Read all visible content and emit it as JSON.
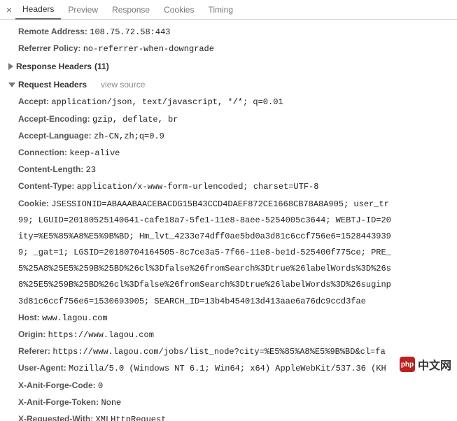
{
  "tabs": {
    "headers": "Headers",
    "preview": "Preview",
    "response": "Response",
    "cookies": "Cookies",
    "timing": "Timing"
  },
  "general": {
    "remote_address_label": "Remote Address:",
    "remote_address_value": "108.75.72.58:443",
    "referrer_policy_label": "Referrer Policy:",
    "referrer_policy_value": "no-referrer-when-downgrade"
  },
  "response_section": {
    "title": "Response Headers",
    "count": "(11)"
  },
  "request_section": {
    "title": "Request Headers",
    "view_source": "view source"
  },
  "request_headers": {
    "accept_label": "Accept:",
    "accept_value": "application/json, text/javascript, */*; q=0.01",
    "accept_encoding_label": "Accept-Encoding:",
    "accept_encoding_value": "gzip, deflate, br",
    "accept_language_label": "Accept-Language:",
    "accept_language_value": "zh-CN,zh;q=0.9",
    "connection_label": "Connection:",
    "connection_value": "keep-alive",
    "content_length_label": "Content-Length:",
    "content_length_value": "23",
    "content_type_label": "Content-Type:",
    "content_type_value": "application/x-www-form-urlencoded; charset=UTF-8",
    "cookie_label": "Cookie:",
    "cookie_line1": "JSESSIONID=ABAAABAACEBACDG15B43CCD4DAEF872CE1668CB78A8A905; user_tr",
    "cookie_line2": "99; LGUID=20180525140641-cafe18a7-5fe1-11e8-8aee-5254005c3644; WEBTJ-ID=20",
    "cookie_line3": "ity=%E5%85%A8%E5%9B%BD; Hm_lvt_4233e74dff0ae5bd0a3d81c6ccf756e6=1528443939",
    "cookie_line4": "9; _gat=1; LGSID=20180704164505-8c7ce3a5-7f66-11e8-be1d-525400f775ce; PRE_",
    "cookie_line5": "5%25A8%25E5%259B%25BD%26cl%3Dfalse%26fromSearch%3Dtrue%26labelWords%3D%26s",
    "cookie_line6": "8%25E5%259B%25BD%26cl%3Dfalse%26fromSearch%3Dtrue%26labelWords%3D%26suginp",
    "cookie_line7": "3d81c6ccf756e6=1530693905; SEARCH_ID=13b4b454013d413aae6a76dc9ccd3fae",
    "host_label": "Host:",
    "host_value": "www.lagou.com",
    "origin_label": "Origin:",
    "origin_value": "https://www.lagou.com",
    "referer_label": "Referer:",
    "referer_value": "https://www.lagou.com/jobs/list_node?city=%E5%85%A8%E5%9B%BD&cl=fa",
    "user_agent_label": "User-Agent:",
    "user_agent_value": "Mozilla/5.0 (Windows NT 6.1; Win64; x64) AppleWebKit/537.36 (KH",
    "x_anit_forge_code_label": "X-Anit-Forge-Code:",
    "x_anit_forge_code_value": "0",
    "x_anit_forge_token_label": "X-Anit-Forge-Token:",
    "x_anit_forge_token_value": "None",
    "x_requested_with_label": "X-Requested-With:",
    "x_requested_with_value": "XMLHttpRequest"
  },
  "watermark": {
    "logo": "php",
    "text": "中文网"
  }
}
